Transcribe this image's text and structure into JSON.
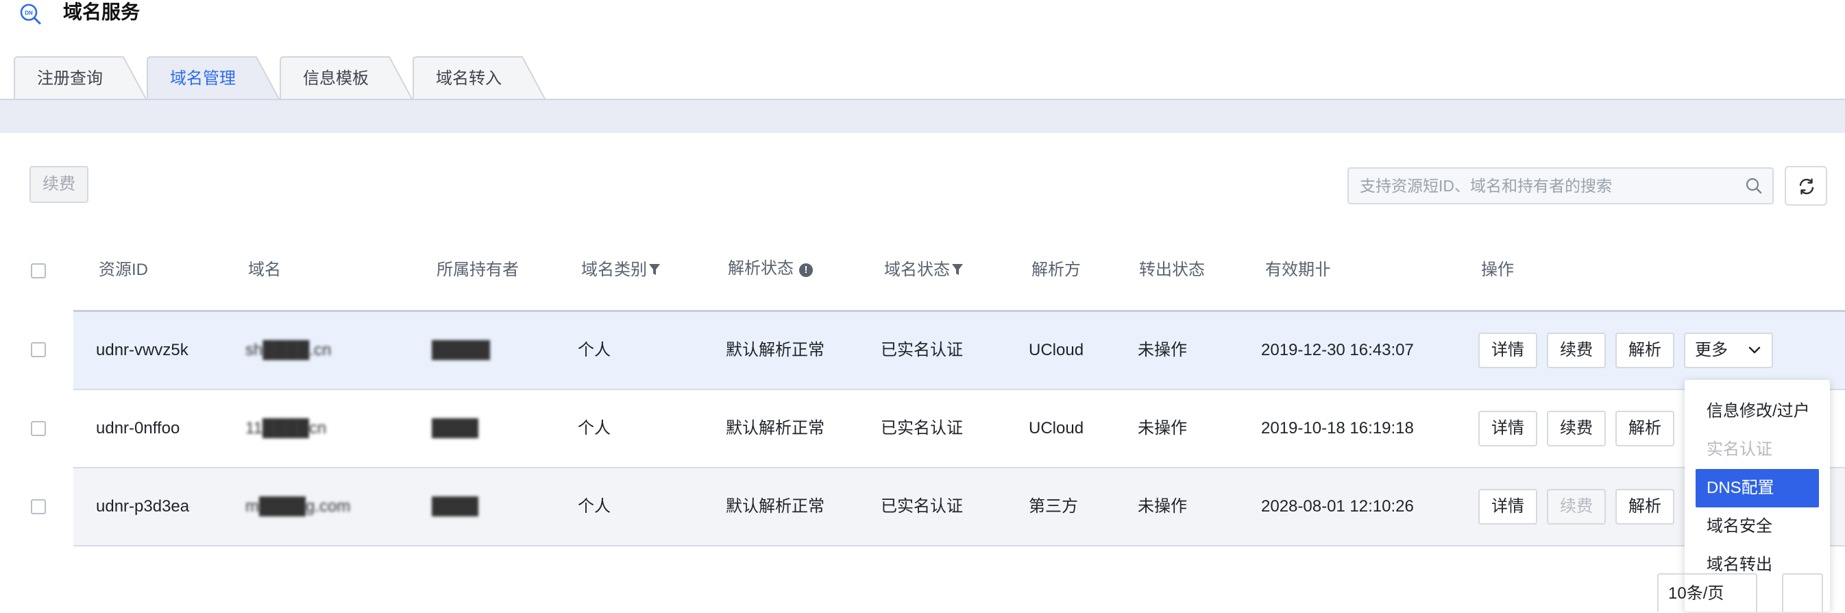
{
  "header": {
    "title": "域名服务",
    "logo_icon": "dns-search-icon"
  },
  "tabs": [
    {
      "label": "注册查询",
      "active": false
    },
    {
      "label": "域名管理",
      "active": true
    },
    {
      "label": "信息模板",
      "active": false
    },
    {
      "label": "域名转入",
      "active": false
    }
  ],
  "toolbar": {
    "renew_label": "续费",
    "search_placeholder": "支持资源短ID、域名和持有者的搜索",
    "search_icon": "search-icon",
    "refresh_icon": "refresh-icon"
  },
  "table": {
    "columns": {
      "resource_id": "资源ID",
      "domain": "域名",
      "owner": "所属持有者",
      "type": "域名类别",
      "resolve_status": "解析状态",
      "domain_status": "域名状态",
      "resolver": "解析方",
      "transfer_status": "转出状态",
      "expiry": "有效期卝",
      "actions": "操作"
    },
    "rows": [
      {
        "resource_id": "udnr-vwvz5k",
        "domain": "sh████.cn",
        "owner": "█████",
        "type": "个人",
        "resolve_status": "默认解析正常",
        "domain_status": "已实名认证",
        "resolver": "UCloud",
        "transfer_status": "未操作",
        "expiry": "2019-12-30 16:43:07",
        "detail": "详情",
        "renew": "续费",
        "resolve": "解析",
        "more": "更多",
        "renew_disabled": false
      },
      {
        "resource_id": "udnr-0nffoo",
        "domain": "11████cn",
        "owner": "████",
        "type": "个人",
        "resolve_status": "默认解析正常",
        "domain_status": "已实名认证",
        "resolver": "UCloud",
        "transfer_status": "未操作",
        "expiry": "2019-10-18 16:19:18",
        "detail": "详情",
        "renew": "续费",
        "resolve": "解析",
        "renew_disabled": false
      },
      {
        "resource_id": "udnr-p3d3ea",
        "domain": "m████g.com",
        "owner": "████",
        "type": "个人",
        "resolve_status": "默认解析正常",
        "domain_status": "已实名认证",
        "resolver": "第三方",
        "transfer_status": "未操作",
        "expiry": "2028-08-01 12:10:26",
        "detail": "详情",
        "renew": "续费",
        "resolve": "解析",
        "renew_disabled": true
      }
    ]
  },
  "dropdown": {
    "items": [
      {
        "label": "信息修改/过户",
        "state": "normal"
      },
      {
        "label": "实名认证",
        "state": "disabled"
      },
      {
        "label": "DNS配置",
        "state": "active"
      },
      {
        "label": "域名安全",
        "state": "normal"
      },
      {
        "label": "域名转出",
        "state": "normal"
      }
    ]
  },
  "pagination": {
    "page_size": "10条/页"
  },
  "colors": {
    "accent": "#2f62e6",
    "row_highlight": "#eaf1fc",
    "row_alt": "#f2f4f8",
    "tab_bar": "#e9ecf5"
  }
}
